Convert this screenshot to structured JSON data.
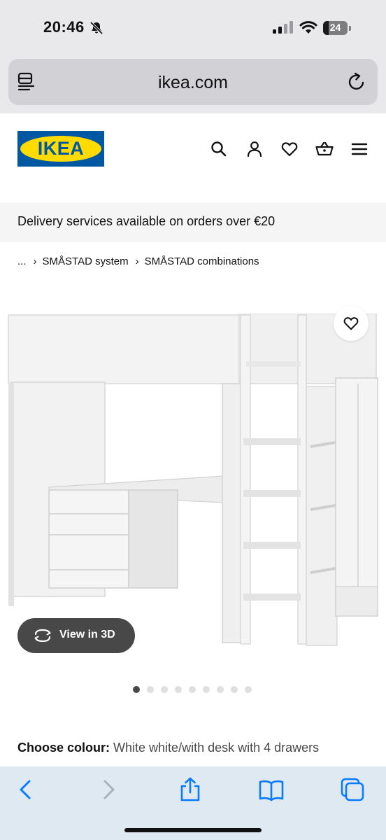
{
  "status_bar": {
    "time": "20:46",
    "battery_level": "24",
    "battery_fraction": 0.24
  },
  "browser": {
    "url": "ikea.com"
  },
  "header": {
    "logo_text": "IKEA",
    "icons": [
      "search-icon",
      "account-icon",
      "heart-icon",
      "basket-icon",
      "menu-icon"
    ]
  },
  "banner": {
    "text": "Delivery services available on orders over €20"
  },
  "breadcrumb": {
    "ellipsis": "...",
    "items": [
      "SMÅSTAD system",
      "SMÅSTAD combinations"
    ]
  },
  "product": {
    "view_3d_label": "View in 3D",
    "image_count": 9,
    "active_image": 1,
    "choose_colour_label": "Choose colour:",
    "colour_value": "White white/with desk with 4 drawers"
  },
  "colors": {
    "ikea_blue": "#0058a3",
    "ikea_yellow": "#ffdb00",
    "safari_blue": "#0a7aff"
  }
}
